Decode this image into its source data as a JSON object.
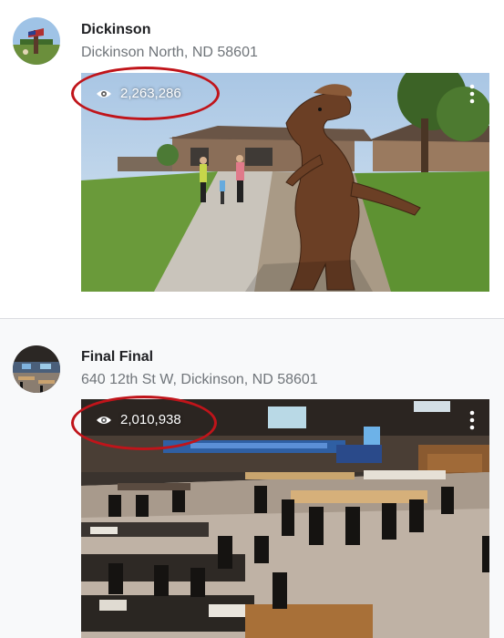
{
  "places": [
    {
      "name": "Dickinson",
      "address": "Dickinson North, ND 58601",
      "views": "2,263,286",
      "photo_icon": "eye-icon",
      "menu_icon": "more-vert-icon"
    },
    {
      "name": "Final Final",
      "address": "640 12th St W, Dickinson, ND 58601",
      "views": "2,010,938",
      "photo_icon": "eye-icon",
      "menu_icon": "more-vert-icon"
    }
  ],
  "colors": {
    "annotation": "#c0141a",
    "title": "#202124",
    "address": "#70757a",
    "divider": "#dadce0"
  }
}
